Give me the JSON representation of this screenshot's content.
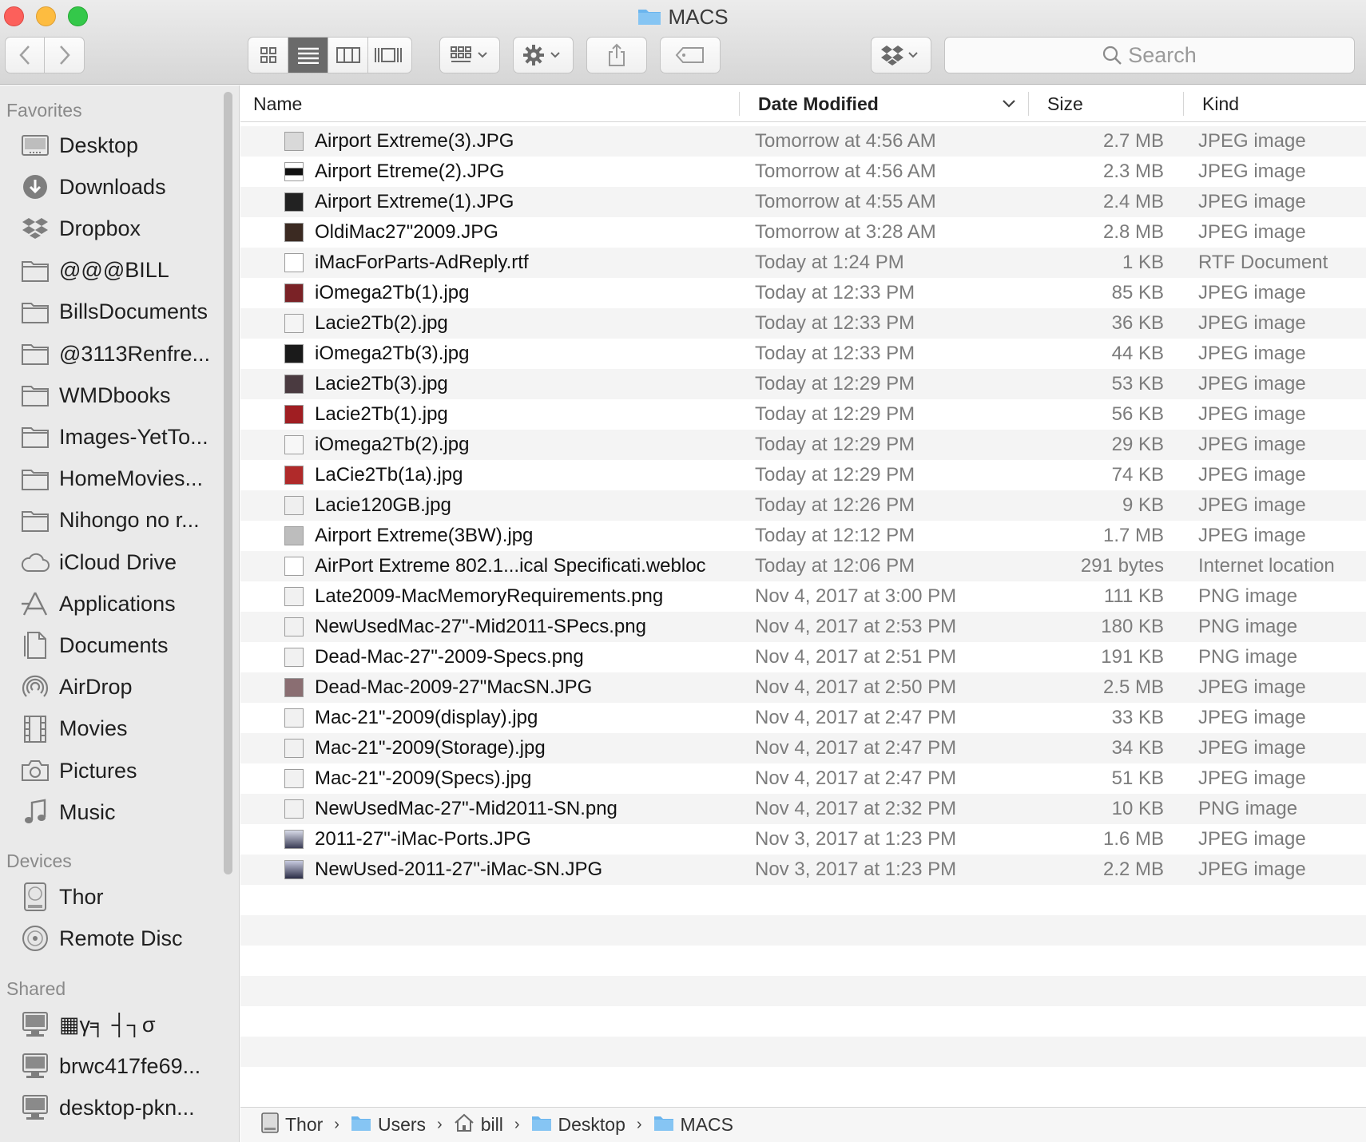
{
  "window": {
    "title": "MACS"
  },
  "toolbar": {
    "back_label": "‹",
    "forward_label": "›",
    "search_placeholder": "Search"
  },
  "sidebar": {
    "favorites_heading": "Favorites",
    "favorites": [
      {
        "label": "Desktop",
        "icon": "desktop-icon"
      },
      {
        "label": "Downloads",
        "icon": "downloads-icon"
      },
      {
        "label": "Dropbox",
        "icon": "dropbox-icon"
      },
      {
        "label": "@@@BILL",
        "icon": "folder-icon"
      },
      {
        "label": "BillsDocuments",
        "icon": "folder-icon"
      },
      {
        "label": "@3113Renfre...",
        "icon": "folder-icon"
      },
      {
        "label": "WMDbooks",
        "icon": "folder-icon"
      },
      {
        "label": "Images-YetTo...",
        "icon": "folder-icon"
      },
      {
        "label": "HomeMovies...",
        "icon": "folder-icon"
      },
      {
        "label": "Nihongo no r...",
        "icon": "folder-icon"
      },
      {
        "label": "iCloud Drive",
        "icon": "cloud-icon"
      },
      {
        "label": "Applications",
        "icon": "applications-icon"
      },
      {
        "label": "Documents",
        "icon": "documents-icon"
      },
      {
        "label": "AirDrop",
        "icon": "airdrop-icon"
      },
      {
        "label": "Movies",
        "icon": "movies-icon"
      },
      {
        "label": "Pictures",
        "icon": "camera-icon"
      },
      {
        "label": "Music",
        "icon": "music-icon"
      }
    ],
    "devices_heading": "Devices",
    "devices": [
      {
        "label": "Thor",
        "icon": "hard-drive-icon"
      },
      {
        "label": "Remote Disc",
        "icon": "disc-icon"
      }
    ],
    "shared_heading": "Shared",
    "shared": [
      {
        "label": "▦γ╕ ┤┐σ",
        "icon": "computer-icon"
      },
      {
        "label": "brwc417fe69...",
        "icon": "computer-icon"
      },
      {
        "label": "desktop-pkn...",
        "icon": "computer-icon"
      }
    ]
  },
  "columns": {
    "name": "Name",
    "date": "Date Modified",
    "size": "Size",
    "kind": "Kind"
  },
  "files": [
    {
      "name": "Airport Extreme(3).JPG",
      "date": "Tomorrow at 4:56 AM",
      "size": "2.7 MB",
      "kind": "JPEG image"
    },
    {
      "name": "Airport Etreme(2).JPG",
      "date": "Tomorrow at 4:56 AM",
      "size": "2.3 MB",
      "kind": "JPEG image"
    },
    {
      "name": "Airport Extreme(1).JPG",
      "date": "Tomorrow at 4:55 AM",
      "size": "2.4 MB",
      "kind": "JPEG image"
    },
    {
      "name": "OldiMac27\"2009.JPG",
      "date": "Tomorrow at 3:28 AM",
      "size": "2.8 MB",
      "kind": "JPEG image"
    },
    {
      "name": "iMacForParts-AdReply.rtf",
      "date": "Today at 1:24 PM",
      "size": "1 KB",
      "kind": "RTF Document"
    },
    {
      "name": "iOmega2Tb(1).jpg",
      "date": "Today at 12:33 PM",
      "size": "85 KB",
      "kind": "JPEG image"
    },
    {
      "name": "Lacie2Tb(2).jpg",
      "date": "Today at 12:33 PM",
      "size": "36 KB",
      "kind": "JPEG image"
    },
    {
      "name": "iOmega2Tb(3).jpg",
      "date": "Today at 12:33 PM",
      "size": "44 KB",
      "kind": "JPEG image"
    },
    {
      "name": "Lacie2Tb(3).jpg",
      "date": "Today at 12:29 PM",
      "size": "53 KB",
      "kind": "JPEG image"
    },
    {
      "name": "Lacie2Tb(1).jpg",
      "date": "Today at 12:29 PM",
      "size": "56 KB",
      "kind": "JPEG image"
    },
    {
      "name": "iOmega2Tb(2).jpg",
      "date": "Today at 12:29 PM",
      "size": "29 KB",
      "kind": "JPEG image"
    },
    {
      "name": "LaCie2Tb(1a).jpg",
      "date": "Today at 12:29 PM",
      "size": "74 KB",
      "kind": "JPEG image"
    },
    {
      "name": "Lacie120GB.jpg",
      "date": "Today at 12:26 PM",
      "size": "9 KB",
      "kind": "JPEG image"
    },
    {
      "name": "Airport Extreme(3BW).jpg",
      "date": "Today at 12:12 PM",
      "size": "1.7 MB",
      "kind": "JPEG image"
    },
    {
      "name": "AirPort Extreme 802.1...ical Specificati.webloc",
      "date": "Today at 12:06 PM",
      "size": "291 bytes",
      "kind": "Internet location"
    },
    {
      "name": "Late2009-MacMemoryRequirements.png",
      "date": "Nov 4, 2017 at 3:00 PM",
      "size": "111 KB",
      "kind": "PNG image"
    },
    {
      "name": "NewUsedMac-27\"-Mid2011-SPecs.png",
      "date": "Nov 4, 2017 at 2:53 PM",
      "size": "180 KB",
      "kind": "PNG image"
    },
    {
      "name": "Dead-Mac-27\"-2009-Specs.png",
      "date": "Nov 4, 2017 at 2:51 PM",
      "size": "191 KB",
      "kind": "PNG image"
    },
    {
      "name": "Dead-Mac-2009-27\"MacSN.JPG",
      "date": "Nov 4, 2017 at 2:50 PM",
      "size": "2.5 MB",
      "kind": "JPEG image"
    },
    {
      "name": "Mac-21\"-2009(display).jpg",
      "date": "Nov 4, 2017 at 2:47 PM",
      "size": "33 KB",
      "kind": "JPEG image"
    },
    {
      "name": "Mac-21\"-2009(Storage).jpg",
      "date": "Nov 4, 2017 at 2:47 PM",
      "size": "34 KB",
      "kind": "JPEG image"
    },
    {
      "name": "Mac-21\"-2009(Specs).jpg",
      "date": "Nov 4, 2017 at 2:47 PM",
      "size": "51 KB",
      "kind": "JPEG image"
    },
    {
      "name": "NewUsedMac-27\"-Mid2011-SN.png",
      "date": "Nov 4, 2017 at 2:32 PM",
      "size": "10 KB",
      "kind": "PNG image"
    },
    {
      "name": "2011-27\"-iMac-Ports.JPG",
      "date": "Nov 3, 2017 at 1:23 PM",
      "size": "1.6 MB",
      "kind": "JPEG image"
    },
    {
      "name": "NewUsed-2011-27\"-iMac-SN.JPG",
      "date": "Nov 3, 2017 at 1:23 PM",
      "size": "2.2 MB",
      "kind": "JPEG image"
    }
  ],
  "pathbar": [
    {
      "label": "Thor",
      "icon": "hard-drive-icon"
    },
    {
      "label": "Users",
      "icon": "folder-icon"
    },
    {
      "label": "bill",
      "icon": "home-icon"
    },
    {
      "label": "Desktop",
      "icon": "folder-icon"
    },
    {
      "label": "MACS",
      "icon": "folder-icon"
    }
  ],
  "colors": {
    "folder_blue": "#6bb5ee",
    "active_segment": "#6a6a6a",
    "row_alt": "#f4f4f4"
  }
}
